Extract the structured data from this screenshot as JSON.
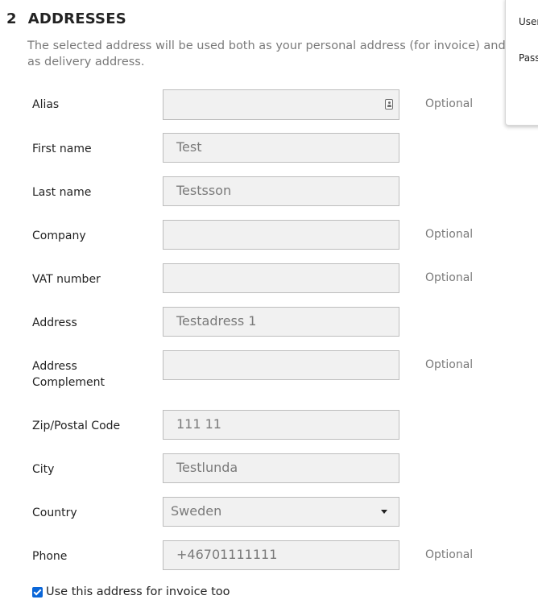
{
  "section": {
    "number": "2",
    "title": "ADDRESSES",
    "description": "The selected address will be used both as your personal address (for invoice) and as delivery address."
  },
  "fields": [
    {
      "label": "Alias",
      "value": "",
      "optional": "Optional",
      "icon": "contact-card-icon"
    },
    {
      "label": "First name",
      "value": "Test",
      "optional": ""
    },
    {
      "label": "Last name",
      "value": "Testsson",
      "optional": ""
    },
    {
      "label": "Company",
      "value": "",
      "optional": "Optional"
    },
    {
      "label": "VAT number",
      "value": "",
      "optional": "Optional"
    },
    {
      "label": "Address",
      "value": "Testadress 1",
      "optional": ""
    },
    {
      "label": "Address Complement",
      "value": "",
      "optional": "Optional"
    },
    {
      "label": "Zip/Postal Code",
      "value": "111 11",
      "optional": ""
    },
    {
      "label": "City",
      "value": "Testlunda",
      "optional": ""
    },
    {
      "label": "Country",
      "value": "Sweden",
      "optional": "",
      "type": "select"
    },
    {
      "label": "Phone",
      "value": "+46701111111",
      "optional": "Optional"
    }
  ],
  "invoice_checkbox": {
    "label": "Use this address for invoice too",
    "checked": true
  },
  "login_popup": {
    "username_label": "User",
    "password_label": "Pass"
  },
  "colors": {
    "checkbox": "#0a66d8",
    "field_bg": "#f1f1f1"
  }
}
